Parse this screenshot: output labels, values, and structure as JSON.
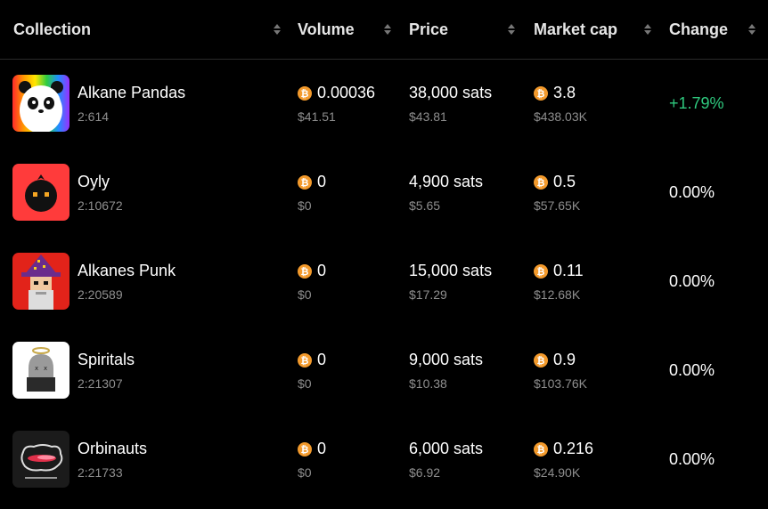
{
  "header": {
    "collection": "Collection",
    "volume": "Volume",
    "price": "Price",
    "market_cap": "Market cap",
    "change": "Change"
  },
  "colors": {
    "positive": "#2fca7f",
    "neutral": "#ffffff",
    "coin": "#f39a2c"
  },
  "rows": [
    {
      "name": "Alkane Pandas",
      "id": "2:614",
      "volume_btc": "0.00036",
      "volume_usd": "$41.51",
      "price_sats": "38,000 sats",
      "price_usd": "$43.81",
      "mcap_btc": "3.8",
      "mcap_usd": "$438.03K",
      "change": "+1.79%",
      "avatar_icon": "panda-avatar-icon"
    },
    {
      "name": "Oyly",
      "id": "2:10672",
      "volume_btc": "0",
      "volume_usd": "$0",
      "price_sats": "4,900 sats",
      "price_usd": "$5.65",
      "mcap_btc": "0.5",
      "mcap_usd": "$57.65K",
      "change": "0.00%",
      "avatar_icon": "oyly-blob-avatar-icon"
    },
    {
      "name": "Alkanes Punk",
      "id": "2:20589",
      "volume_btc": "0",
      "volume_usd": "$0",
      "price_sats": "15,000 sats",
      "price_usd": "$17.29",
      "mcap_btc": "0.11",
      "mcap_usd": "$12.68K",
      "change": "0.00%",
      "avatar_icon": "wizard-punk-avatar-icon"
    },
    {
      "name": "Spiritals",
      "id": "2:21307",
      "volume_btc": "0",
      "volume_usd": "$0",
      "price_sats": "9,000 sats",
      "price_usd": "$10.38",
      "mcap_btc": "0.9",
      "mcap_usd": "$103.76K",
      "change": "0.00%",
      "avatar_icon": "ghost-avatar-icon"
    },
    {
      "name": "Orbinauts",
      "id": "2:21733",
      "volume_btc": "0",
      "volume_usd": "$0",
      "price_sats": "6,000 sats",
      "price_usd": "$6.92",
      "mcap_btc": "0.216",
      "mcap_usd": "$24.90K",
      "change": "0.00%",
      "avatar_icon": "orbinauts-logo-avatar-icon"
    }
  ]
}
